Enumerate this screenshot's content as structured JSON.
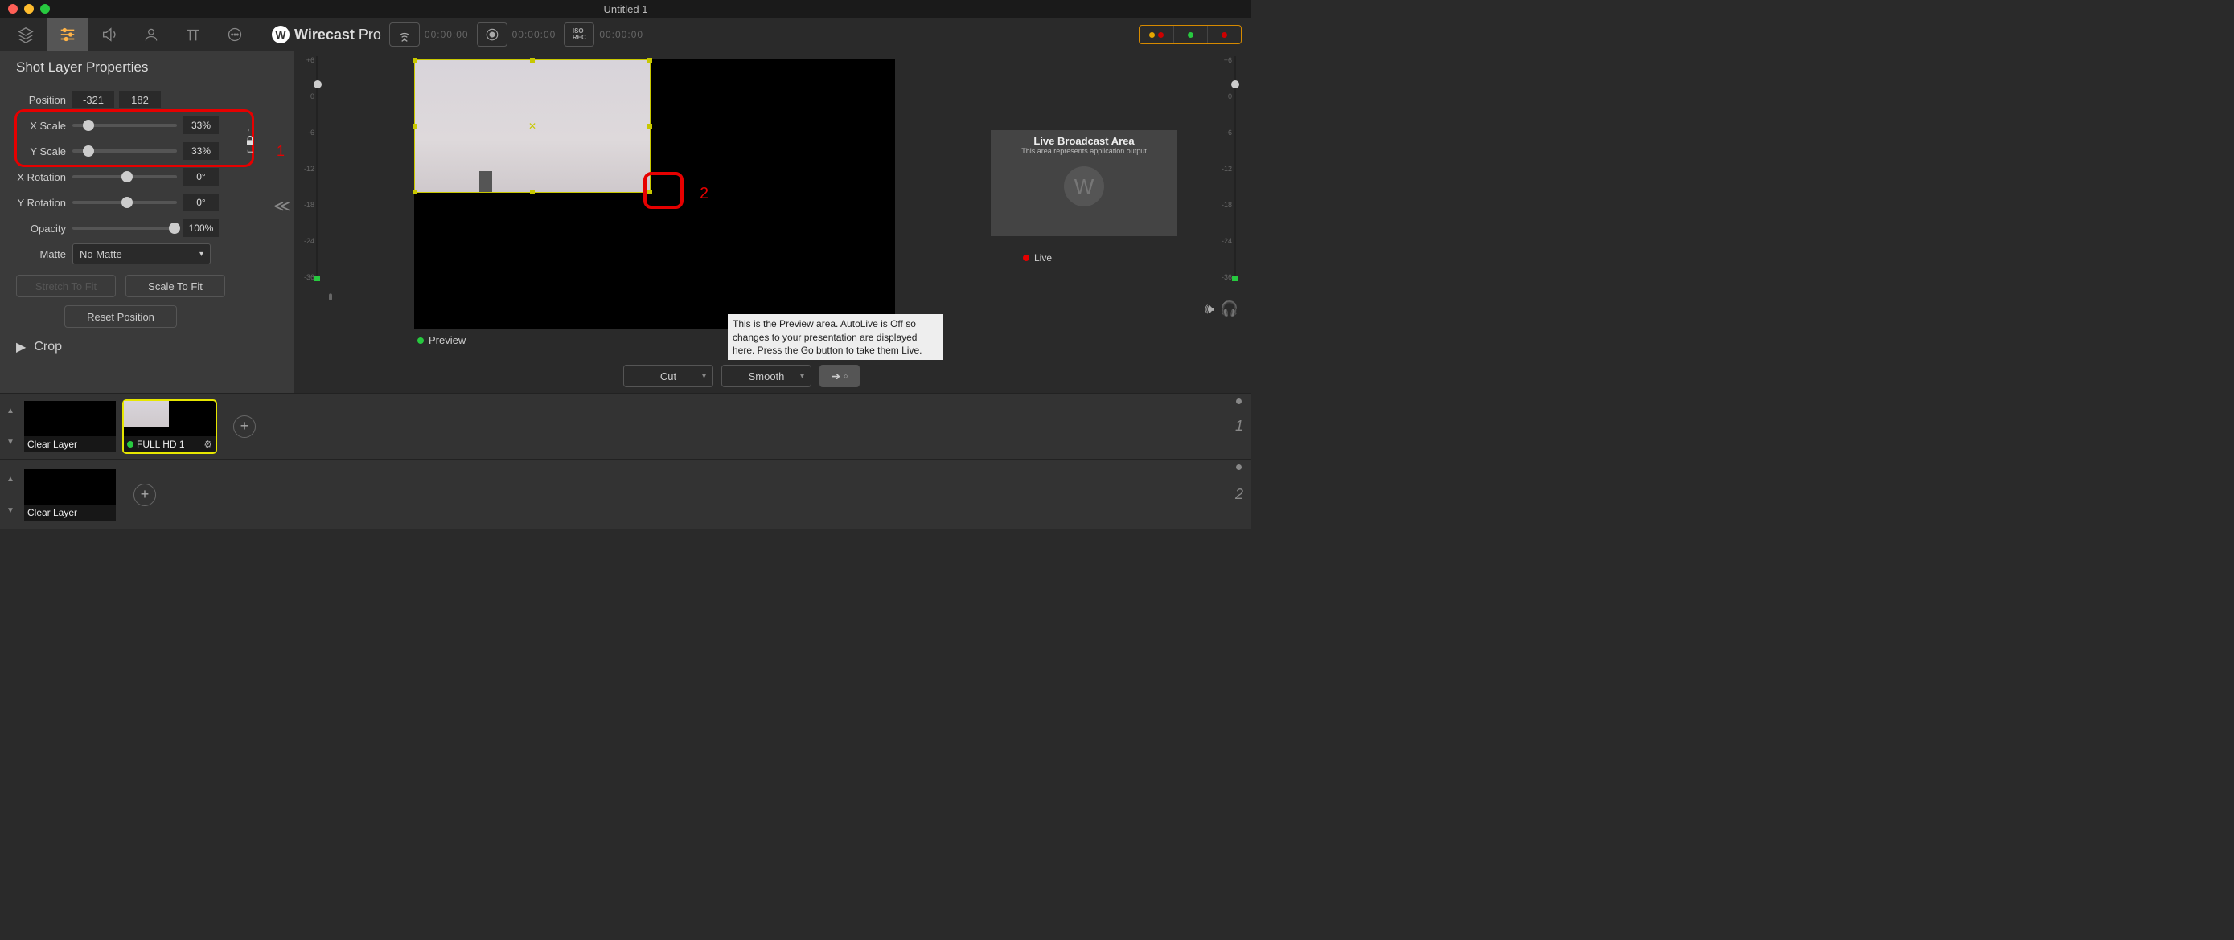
{
  "window": {
    "title": "Untitled 1"
  },
  "brand": {
    "name_bold": "Wirecast",
    "name_light": " Pro",
    "logo_letter": "W"
  },
  "timecodes": {
    "stream": "00:00:00",
    "record": "00:00:00",
    "iso": "00:00:00"
  },
  "panel": {
    "title": "Shot Layer Properties",
    "position_label": "Position",
    "position_x": "-321",
    "position_y": "182",
    "x_scale_label": "X Scale",
    "x_scale_value": "33%",
    "y_scale_label": "Y Scale",
    "y_scale_value": "33%",
    "x_rotation_label": "X Rotation",
    "x_rotation_value": "0°",
    "y_rotation_label": "Y Rotation",
    "y_rotation_value": "0°",
    "opacity_label": "Opacity",
    "opacity_value": "100%",
    "matte_label": "Matte",
    "matte_value": "No Matte",
    "stretch_btn": "Stretch To Fit",
    "scale_btn": "Scale To Fit",
    "reset_btn": "Reset Position",
    "crop_label": "Crop"
  },
  "preview": {
    "label": "Preview",
    "tooltip": "This is the Preview area.  AutoLive is Off so changes to your presentation are displayed here.  Press the Go button to take them Live."
  },
  "live": {
    "title": "Live Broadcast Area",
    "subtitle": "This area represents application output",
    "label": "Live"
  },
  "transition": {
    "cut": "Cut",
    "smooth": "Smooth"
  },
  "meter_ticks": [
    "+6",
    "0",
    "-6",
    "-12",
    "-18",
    "-24",
    "-36"
  ],
  "annotations": {
    "one": "1",
    "two": "2"
  },
  "shots": {
    "row1": {
      "clear": "Clear Layer",
      "shot1": "FULL HD 1",
      "page": "1"
    },
    "row2": {
      "clear": "Clear Layer",
      "page": "2"
    }
  }
}
